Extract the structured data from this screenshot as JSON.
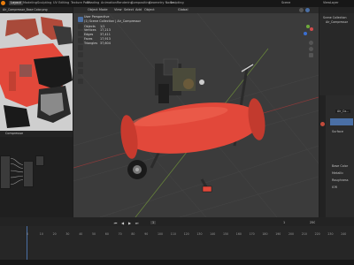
{
  "workspace_tabs": [
    "Layout",
    "Modeling",
    "Sculpting",
    "UV Editing",
    "Texture Paint",
    "Shading",
    "Animation",
    "Rendering",
    "Compositing",
    "Geometry Nodes",
    "Scripting"
  ],
  "top_right": {
    "scene": "Scene",
    "view_layer": "ViewLayer"
  },
  "image_editor": {
    "title": "Air_Compressor_Base Color.png"
  },
  "node_editor": {
    "title": "Compressor"
  },
  "viewport": {
    "header_items": [
      "Object Mode",
      "View",
      "Select",
      "Add",
      "Object"
    ],
    "global_label": "Global",
    "overlay": {
      "line1": "User Perspective",
      "line2": "(1) Scene Collection | Air_Compressor",
      "objects_label": "Objects",
      "objects_value": "1/1",
      "vertices_label": "Vertices",
      "vertices_value": "17,213",
      "edges_label": "Edges",
      "edges_value": "37,411",
      "faces_label": "Faces",
      "faces_value": "17,913",
      "tris_label": "Triangles",
      "tris_value": "37,604"
    }
  },
  "outliner": {
    "item1": "Scene Collection",
    "item2": "Air_Compressor"
  },
  "properties": {
    "object_name": "Air_Co...",
    "sections": [
      "Surface",
      "Base Color",
      "Metallic",
      "Roughness",
      "IOR",
      "Subsurface",
      "Specular",
      "Transmission",
      "Coat",
      "Sheen",
      "Emission",
      "Volume"
    ],
    "material_label": "Material"
  },
  "timeline": {
    "frame_numbers": [
      "0",
      "10",
      "20",
      "30",
      "40",
      "50",
      "60",
      "70",
      "80",
      "90",
      "100",
      "110",
      "120",
      "130",
      "140",
      "150",
      "160",
      "170",
      "180",
      "190",
      "200",
      "210",
      "220",
      "230",
      "240",
      "250"
    ],
    "current_frame": "1",
    "start": "1",
    "end": "250"
  },
  "colors": {
    "tank_red": "#e2483a",
    "accent_blue": "#4a6fa5",
    "bg": "#1d1d1d"
  }
}
